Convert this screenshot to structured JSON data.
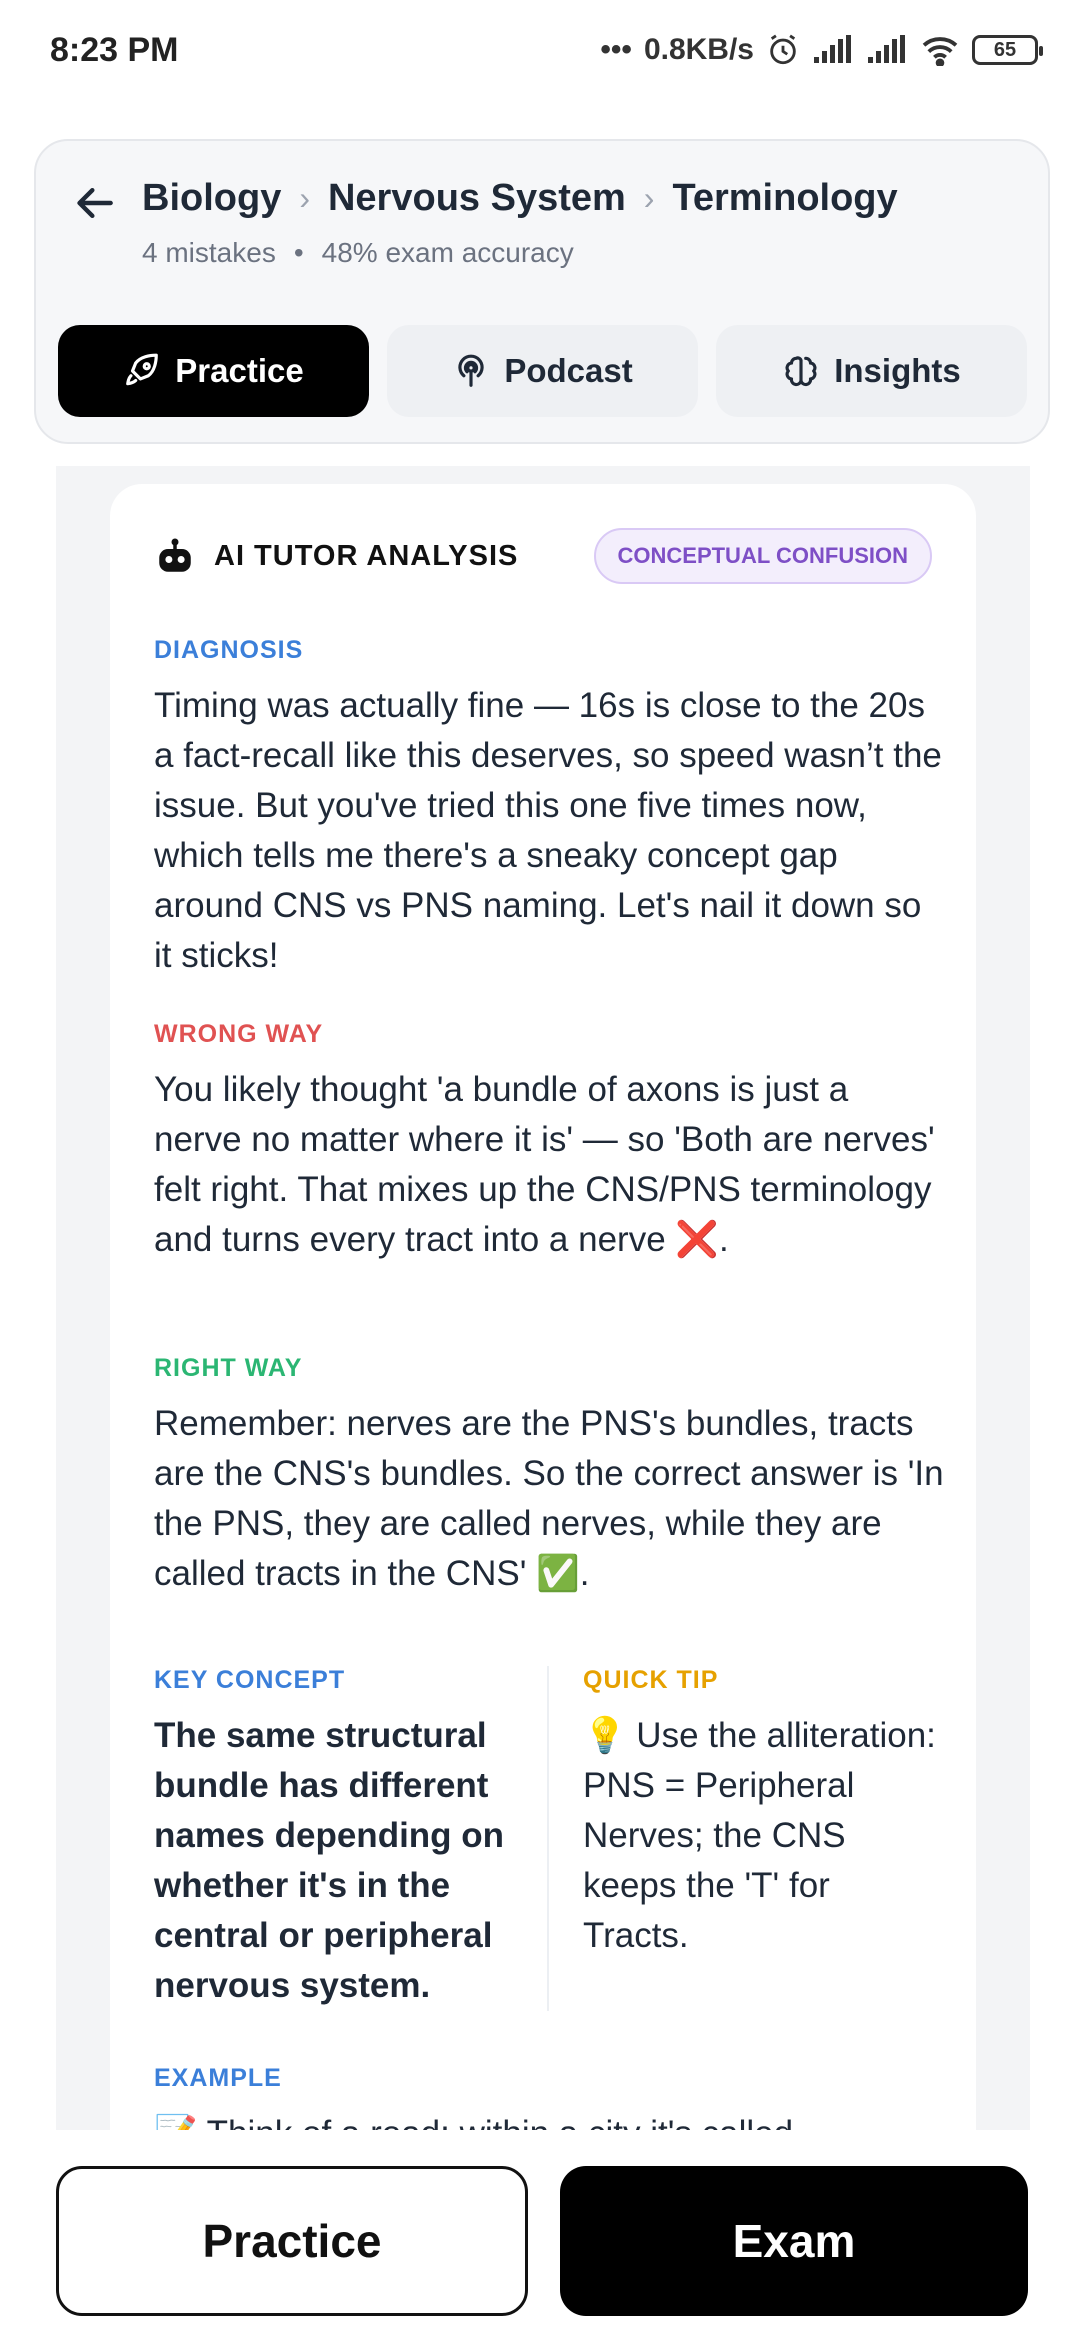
{
  "status": {
    "time": "8:23 PM",
    "network": "0.8KB/s",
    "battery": "65"
  },
  "header": {
    "breadcrumb": [
      "Biology",
      "Nervous System",
      "Terminology"
    ],
    "mistakes": "4 mistakes",
    "separator": "•",
    "accuracy": "48% exam accuracy"
  },
  "tabs": [
    {
      "label": "Practice",
      "icon": "rocket-icon",
      "active": true
    },
    {
      "label": "Podcast",
      "icon": "podcast-icon",
      "active": false
    },
    {
      "label": "Insights",
      "icon": "brain-icon",
      "active": false
    }
  ],
  "analysis": {
    "title": "AI TUTOR ANALYSIS",
    "badge": "CONCEPTUAL CONFUSION",
    "diagnosis_label": "DIAGNOSIS",
    "diagnosis_text": "Timing was actually fine — 16s is close to the 20s a fact-recall like this deserves, so speed wasn’t the issue. But you've tried this one five times now, which tells me there's a sneaky concept gap around CNS vs PNS naming. Let's nail it down so it sticks!",
    "wrong_label": "WRONG WAY",
    "wrong_text": "You likely thought 'a bundle of axons is just a nerve no matter where it is' — so 'Both are nerves' felt right. That mixes up the CNS/PNS terminology and turns every tract into a nerve ❌.",
    "right_label": "RIGHT WAY",
    "right_text": "Remember: nerves are the PNS's bundles, tracts are the CNS's bundles. So the correct answer is 'In the PNS, they are called nerves, while they are called tracts in the CNS' ✅.",
    "key_label": "KEY CONCEPT",
    "key_text": "The same structural bundle has different names depending on whether it's in the central or peripheral nervous system.",
    "tip_label": "QUICK TIP",
    "tip_text": "💡 Use the alliteration: PNS = Peripheral Nerves; the CNS keeps the 'T' for Tracts.",
    "example_label": "EXAMPLE",
    "example_text": "📝 Think of a road: within a city it's called"
  },
  "bottom": {
    "practice_label": "Practice",
    "exam_label": "Exam"
  }
}
